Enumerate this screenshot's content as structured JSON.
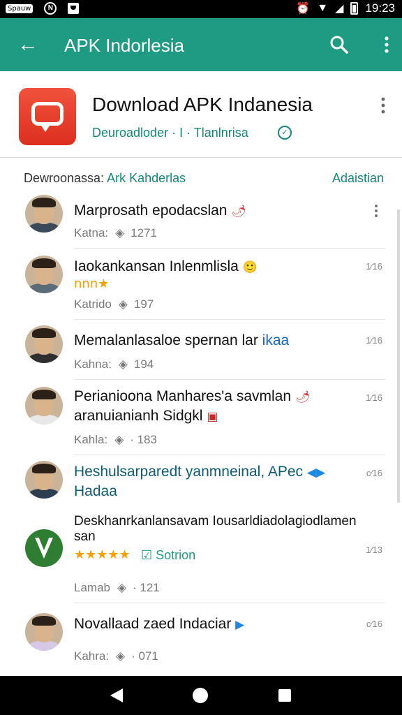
{
  "status_bar": {
    "chip_label": "Spauw",
    "circle_label": "N",
    "time": "19:23"
  },
  "app_bar": {
    "title": "APK Indorlesia",
    "icons": [
      "back-arrow-icon",
      "search-icon",
      "more-vert-icon"
    ]
  },
  "app_card": {
    "name": "Download APK Indanesia",
    "subtitle": "Deuroadloder · I  · Tlanlnrisa",
    "icon": "chat-bubble-icon"
  },
  "section": {
    "title_prefix": "Dewroonassa:",
    "title_accent": "Ark Kahderlas",
    "action": "Adaistian"
  },
  "rows": [
    {
      "title": "Marprosath epodacslan",
      "title_emoji": "🌶",
      "meta_label": "Katna:",
      "meta_count": "1271",
      "time": ""
    },
    {
      "title": "Iaokankansan Inlenmlisla",
      "title_emoji": "🙂",
      "badge_text": "nnn★",
      "meta_label": "Katrido",
      "meta_count": "197",
      "time": "1⁄16"
    },
    {
      "title": "Memalanlasaloe spernan lar",
      "title_highlight": "ikaa",
      "meta_label": "Kahna:",
      "meta_count": "194",
      "time": "1⁄16"
    },
    {
      "title": "Perianioona Manhares'a savmlan",
      "title_line2": "aranuianianh Sidgkl",
      "title_emoji": "🌶",
      "meta_label": "Kahla:",
      "meta_count": "· 183",
      "time": "1⁄16"
    },
    {
      "title": "Heshulsarparedt yanmneinal, APec",
      "title_line2": "Hadaa",
      "meta_label": "",
      "meta_count": "",
      "time": "c⁄16"
    },
    {
      "title": "Deskhanrkanlansavam Iousarldiadolagiodlamen",
      "title_line2": "san",
      "stars": "★★★★★",
      "check_label": "☑ Sotrion",
      "meta_label": "Lamab",
      "meta_count": "· 121",
      "time": "1⁄13"
    },
    {
      "title": "Novallaad zaed Indaciar",
      "meta_label": "Kahra:",
      "meta_count": "· 071",
      "time": "c⁄16"
    }
  ],
  "colors": {
    "app_bar": "#1f9a83",
    "accent": "#14877a",
    "app_icon": "#e8402b",
    "star": "#f5a000"
  }
}
